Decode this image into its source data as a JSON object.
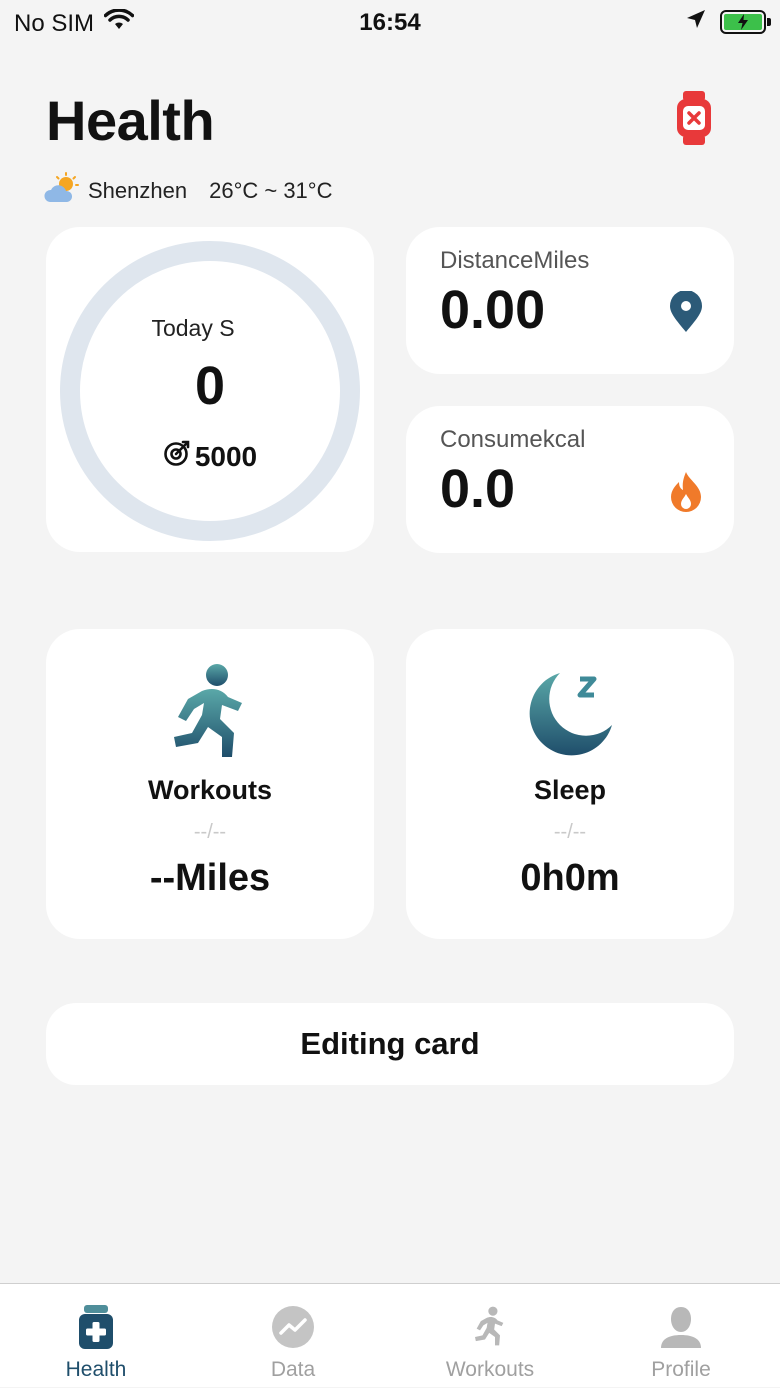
{
  "status_bar": {
    "carrier": "No SIM",
    "time": "16:54"
  },
  "header": {
    "title": "Health"
  },
  "weather": {
    "city": "Shenzhen",
    "temp_range": "26°C ~ 31°C",
    "icon": "partly-cloudy-icon"
  },
  "steps": {
    "label": "s Today  S",
    "value": "0",
    "goal": "5000"
  },
  "distance": {
    "label": "DistanceMiles",
    "value": "0.00",
    "icon": "location-pin-icon",
    "icon_color": "#2c5a78"
  },
  "calories": {
    "label": "Consumekcal",
    "value": "0.0",
    "icon": "flame-icon",
    "icon_color": "#f07a2a"
  },
  "workouts": {
    "title": "Workouts",
    "date": "--/--",
    "value": "--Miles",
    "icon": "running-person-icon"
  },
  "sleep": {
    "title": "Sleep",
    "date": "--/--",
    "value": "0h0m",
    "icon": "moon-sleep-icon"
  },
  "edit_card": {
    "label": "Editing card"
  },
  "tabs": [
    {
      "label": "Health",
      "icon": "health-kit-icon",
      "active": true
    },
    {
      "label": "Data",
      "icon": "trend-chart-icon",
      "active": false
    },
    {
      "label": "Workouts",
      "icon": "running-person-icon",
      "active": false
    },
    {
      "label": "Profile",
      "icon": "person-icon",
      "active": false
    }
  ],
  "colors": {
    "accent": "#1f4e6b",
    "device_alert": "#e8393a",
    "ring": "#dfe6ee"
  }
}
